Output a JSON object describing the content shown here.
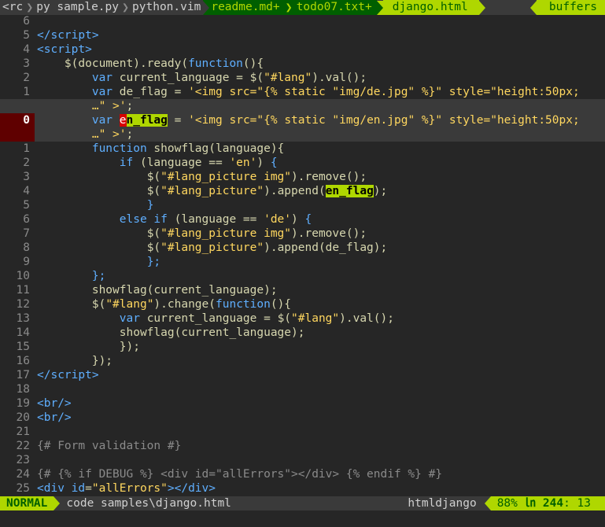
{
  "tabline": {
    "buffers": [
      "<rc",
      "py sample.py",
      "python.vim"
    ],
    "tabs": [
      "readme.md+",
      "todo07.txt+"
    ],
    "active_tab": "django.html",
    "buffers_label": "buffers"
  },
  "editor": {
    "gutter": [
      "6",
      "5",
      "4",
      "3",
      "2",
      "1",
      "0",
      "",
      "1",
      "2",
      "3",
      "4",
      "5",
      "6",
      "7",
      "8",
      "9",
      "10",
      "11",
      "12",
      "13",
      "14",
      "15",
      "16",
      "17",
      "18",
      "19",
      "20",
      "21",
      "22",
      "23",
      "24",
      "25"
    ]
  },
  "status": {
    "mode": "NORMAL",
    "file": "code samples\\django.html",
    "filetype": "htmldjango",
    "percent": "88%",
    "line_icon": "㏑",
    "line": "244",
    "col": ": 13"
  },
  "colors": {
    "accent": "#afd700",
    "accent_dark": "#005f00",
    "cursor_line_gutter": "#5f0000",
    "background": "#262626"
  }
}
